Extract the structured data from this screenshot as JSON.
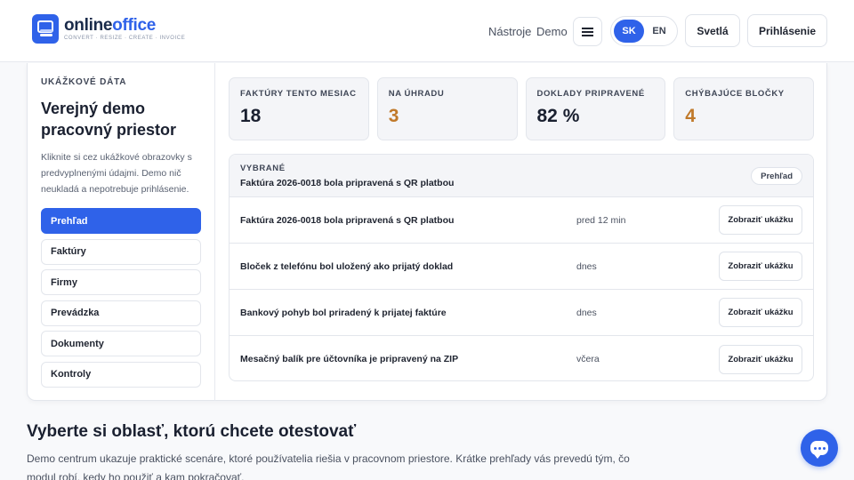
{
  "header": {
    "logo_name_a": "online",
    "logo_name_b": "office",
    "logo_tagline": "CONVERT · RESIZE · CREATE · INVOICE",
    "nav_tools": "Nástroje",
    "nav_demo": "Demo",
    "lang_sk": "SK",
    "lang_en": "EN",
    "theme_label": "Svetlá",
    "login_label": "Prihlásenie"
  },
  "sidebar": {
    "eyebrow": "UKÁŽKOVÉ DÁTA",
    "title": "Verejný demo pracovný priestor",
    "description": "Kliknite si cez ukážkové obrazovky s predvyplnenými údajmi. Demo nič neukladá a nepotrebuje prihlásenie.",
    "items": [
      {
        "label": "Prehľad"
      },
      {
        "label": "Faktúry"
      },
      {
        "label": "Firmy"
      },
      {
        "label": "Prevádzka"
      },
      {
        "label": "Dokumenty"
      },
      {
        "label": "Kontroly"
      }
    ]
  },
  "stats": [
    {
      "label": "FAKTÚRY TENTO MESIAC",
      "value": "18"
    },
    {
      "label": "NA ÚHRADU",
      "value": "3"
    },
    {
      "label": "DOKLADY PRIPRAVENÉ",
      "value": "82 %"
    },
    {
      "label": "CHÝBAJÚCE BLOČKY",
      "value": "4"
    }
  ],
  "list": {
    "eyebrow": "VYBRANÉ",
    "selected": "Faktúra 2026-0018 bola pripravená s QR platbou",
    "badge": "Prehľad",
    "rows": [
      {
        "title": "Faktúra 2026-0018 bola pripravená s QR platbou",
        "time": "pred 12 min",
        "button": "Zobraziť ukážku"
      },
      {
        "title": "Bloček z telefónu bol uložený ako prijatý doklad",
        "time": "dnes",
        "button": "Zobraziť ukážku"
      },
      {
        "title": "Bankový pohyb bol priradený k prijatej faktúre",
        "time": "dnes",
        "button": "Zobraziť ukážku"
      },
      {
        "title": "Mesačný balík pre účtovníka je pripravený na ZIP",
        "time": "včera",
        "button": "Zobraziť ukážku"
      }
    ]
  },
  "section": {
    "title": "Vyberte si oblasť, ktorú chcete otestovať",
    "text": "Demo centrum ukazuje praktické scenáre, ktoré používatelia riešia v pracovnom priestore. Krátke prehľady vás prevedú tým, čo modul robí, kedy ho použiť a kam pokračovať."
  },
  "colors": {
    "accent": "#2f62e9",
    "warning": "#c0792a"
  },
  "icons": {
    "logo": "document-chat-icon",
    "menu": "hamburger-menu-icon",
    "chat": "chat-bubble-icon"
  }
}
